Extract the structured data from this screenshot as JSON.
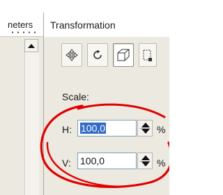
{
  "left_panel": {
    "tab_label": "neters"
  },
  "transformation_panel": {
    "title": "Transformation",
    "toolbar": [
      {
        "icon": "move-icon",
        "active": false
      },
      {
        "icon": "rotate-icon",
        "active": false
      },
      {
        "icon": "scale-icon",
        "active": true
      },
      {
        "icon": "size-icon",
        "active": false
      }
    ],
    "section_label": "Scale:",
    "h": {
      "label": "H:",
      "value": "100,0",
      "unit": "%"
    },
    "v": {
      "label": "V:",
      "value": "100,0",
      "unit": "%"
    }
  },
  "annotation": {
    "color": "#e00000"
  }
}
